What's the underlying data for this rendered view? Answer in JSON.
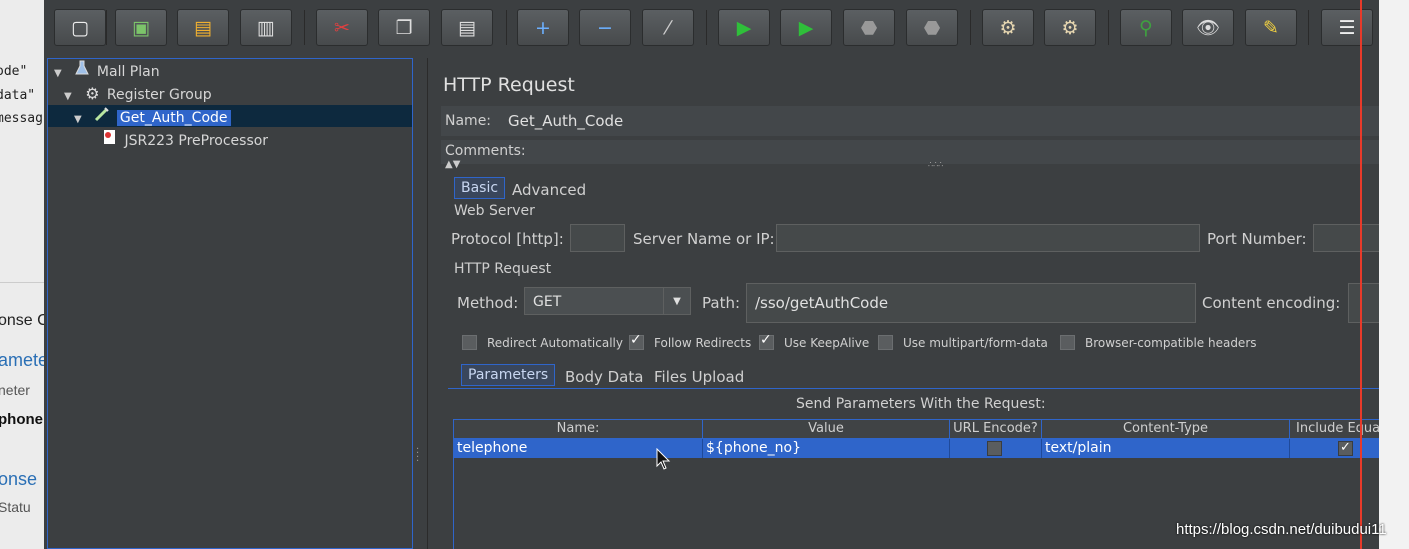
{
  "background_doc": {
    "code_lines": [
      "ode\"",
      "data\"",
      "messag"
    ],
    "fragments": [
      "onse C",
      "ameter",
      "neter",
      "phone",
      "onse",
      "Statu"
    ]
  },
  "toolbar": {
    "buttons": [
      {
        "name": "new-icon",
        "glyph": "▢"
      },
      {
        "name": "templates-icon",
        "glyph": "▣"
      },
      {
        "name": "open-icon",
        "glyph": "▤"
      },
      {
        "name": "save-icon",
        "glyph": "▥"
      },
      {
        "name": "cut-icon",
        "glyph": "✂"
      },
      {
        "name": "copy-icon",
        "glyph": "❐"
      },
      {
        "name": "paste-icon",
        "glyph": "▤"
      },
      {
        "name": "expand-icon",
        "glyph": "+"
      },
      {
        "name": "collapse-icon",
        "glyph": "−"
      },
      {
        "name": "toggle-icon",
        "glyph": "⁄"
      },
      {
        "name": "start-icon",
        "glyph": "▶"
      },
      {
        "name": "start-no-pauses-icon",
        "glyph": "▶"
      },
      {
        "name": "stop-icon",
        "glyph": "⬣"
      },
      {
        "name": "shutdown-icon",
        "glyph": "⬣"
      },
      {
        "name": "clear-icon",
        "glyph": "⚙"
      },
      {
        "name": "clear-all-icon",
        "glyph": "⚙"
      },
      {
        "name": "search-icon",
        "glyph": "⚲"
      },
      {
        "name": "reset-search-icon",
        "glyph": "👁"
      },
      {
        "name": "function-helper-icon",
        "glyph": "✎"
      },
      {
        "name": "log-viewer-icon",
        "glyph": "☰"
      }
    ]
  },
  "tree": {
    "items": [
      {
        "label": "Mall Plan",
        "icon": "flask-icon",
        "twisty": "▼"
      },
      {
        "label": "Register Group",
        "icon": "gear-icon",
        "twisty": "▼"
      },
      {
        "label": "Get_Auth_Code",
        "icon": "pipette-icon",
        "twisty": "▼",
        "selected": true
      },
      {
        "label": "JSR223 PreProcessor",
        "icon": "script-icon",
        "twisty": ""
      }
    ]
  },
  "panel": {
    "title": "HTTP Request",
    "name_label": "Name:",
    "name_value": "Get_Auth_Code",
    "comments_label": "Comments:",
    "tabs": [
      "Basic",
      "Advanced"
    ],
    "web_server": {
      "heading": "Web Server",
      "protocol_label": "Protocol [http]:",
      "protocol_value": "",
      "server_label": "Server Name or IP:",
      "server_value": "",
      "port_label": "Port Number:",
      "port_value": ""
    },
    "http_request": {
      "heading": "HTTP Request",
      "method_label": "Method:",
      "method_value": "GET",
      "path_label": "Path:",
      "path_value": "/sso/getAuthCode",
      "encoding_label": "Content encoding:",
      "encoding_value": ""
    },
    "checkboxes": [
      {
        "label": "Redirect Automatically",
        "checked": false
      },
      {
        "label": "Follow Redirects",
        "checked": true
      },
      {
        "label": "Use KeepAlive",
        "checked": true
      },
      {
        "label": "Use multipart/form-data",
        "checked": false
      },
      {
        "label": "Browser-compatible headers",
        "checked": false
      }
    ],
    "sub_tabs": [
      "Parameters",
      "Body Data",
      "Files Upload"
    ],
    "params": {
      "caption": "Send Parameters With the Request:",
      "columns": [
        "Name:",
        "Value",
        "URL Encode?",
        "Content-Type",
        "Include Equal"
      ],
      "rows": [
        {
          "name": "telephone",
          "value": "${phone_no}",
          "url_encode": false,
          "content_type": "text/plain",
          "include_equals": true
        }
      ]
    }
  },
  "watermark": "https://blog.csdn.net/duibudui11"
}
